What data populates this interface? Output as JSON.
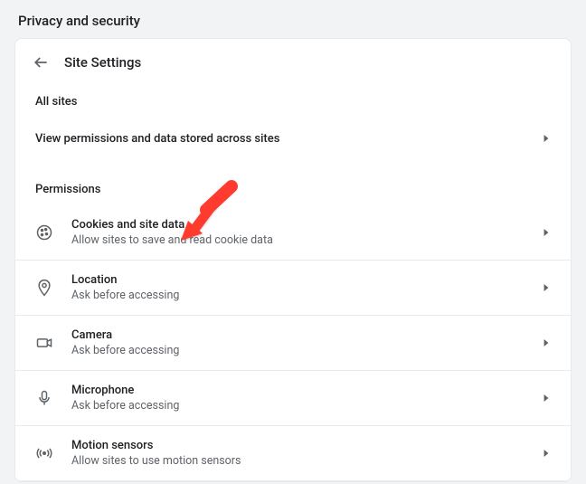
{
  "page_header": "Privacy and security",
  "card": {
    "title": "Site Settings",
    "section_all_sites": "All sites",
    "view_permissions": "View permissions and data stored across sites",
    "section_permissions": "Permissions",
    "rows": {
      "cookies": {
        "title": "Cookies and site data",
        "sub": "Allow sites to save and read cookie data"
      },
      "location": {
        "title": "Location",
        "sub": "Ask before accessing"
      },
      "camera": {
        "title": "Camera",
        "sub": "Ask before accessing"
      },
      "microphone": {
        "title": "Microphone",
        "sub": "Ask before accessing"
      },
      "motion": {
        "title": "Motion sensors",
        "sub": "Allow sites to use motion sensors"
      }
    }
  },
  "annotation": {
    "color": "#ff3b2f"
  }
}
